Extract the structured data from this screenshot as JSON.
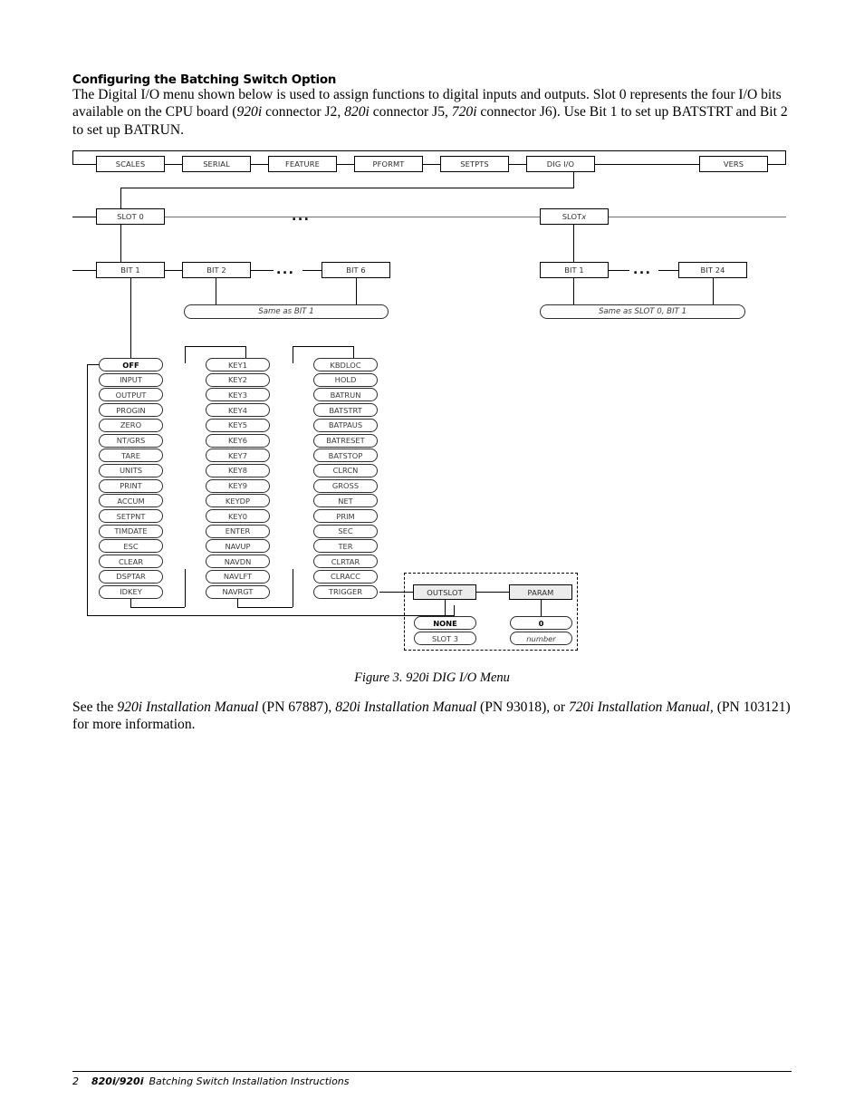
{
  "section": {
    "title": "Configuring the Batching Switch Option",
    "intro_parts": [
      {
        "t": "The Digital I/O menu shown below is used to assign functions to digital inputs and outputs. Slot 0 represents the four I/O bits available on the CPU board (",
        "i": false
      },
      {
        "t": "920i",
        "i": true
      },
      {
        "t": " connector J2, ",
        "i": false
      },
      {
        "t": "820i",
        "i": true
      },
      {
        "t": " connector J5, ",
        "i": false
      },
      {
        "t": "720i",
        "i": true
      },
      {
        "t": " connector J6). Use Bit 1 to set up BATSTRT and Bit 2 to set up BATRUN.",
        "i": false
      }
    ],
    "reference_parts": [
      {
        "t": "See the ",
        "i": false
      },
      {
        "t": "920i Installation Manual",
        "i": true
      },
      {
        "t": " (PN 67887), ",
        "i": false
      },
      {
        "t": "820i Installation Manual",
        "i": true
      },
      {
        "t": " (PN 93018), or ",
        "i": false
      },
      {
        "t": "720i Installation Manual,",
        "i": true
      },
      {
        "t": " (PN 103121) for more information.",
        "i": false
      }
    ]
  },
  "figure": {
    "caption": "Figure 3. 920i DIG I/O Menu",
    "ellipsis": "...",
    "top_menu": [
      {
        "label": "SCALES"
      },
      {
        "label": "SERIAL"
      },
      {
        "label": "FEATURE"
      },
      {
        "label": "PFORMT"
      },
      {
        "label": "SETPTS"
      },
      {
        "label": "DIG I/O"
      },
      {
        "label": "VERS"
      }
    ],
    "slot_row": [
      {
        "label": "SLOT 0"
      },
      {
        "label_pre": "SLOT ",
        "label_italic": "x"
      }
    ],
    "bit_row_left": [
      {
        "label": "BIT 1"
      },
      {
        "label": "BIT 2"
      },
      {
        "label": "BIT 6"
      }
    ],
    "bit_row_right": [
      {
        "label": "BIT 1"
      },
      {
        "label": "BIT 24"
      }
    ],
    "same_as_left": "Same as BIT 1",
    "same_as_right": "Same as SLOT 0, BIT 1",
    "column1": [
      {
        "label": "OFF",
        "bold": true
      },
      {
        "label": "INPUT"
      },
      {
        "label": "OUTPUT"
      },
      {
        "label": "PROGIN"
      },
      {
        "label": "ZERO"
      },
      {
        "label": "NT/GRS"
      },
      {
        "label": "TARE"
      },
      {
        "label": "UNITS"
      },
      {
        "label": "PRINT"
      },
      {
        "label": "ACCUM"
      },
      {
        "label": "SETPNT"
      },
      {
        "label": "TIMDATE"
      },
      {
        "label": "ESC"
      },
      {
        "label": "CLEAR"
      },
      {
        "label": "DSPTAR"
      },
      {
        "label": "IDKEY"
      }
    ],
    "column2": [
      {
        "label": "KEY1"
      },
      {
        "label": "KEY2"
      },
      {
        "label": "KEY3"
      },
      {
        "label": "KEY4"
      },
      {
        "label": "KEY5"
      },
      {
        "label": "KEY6"
      },
      {
        "label": "KEY7"
      },
      {
        "label": "KEY8"
      },
      {
        "label": "KEY9"
      },
      {
        "label": "KEYDP"
      },
      {
        "label": "KEY0"
      },
      {
        "label": "ENTER"
      },
      {
        "label": "NAVUP"
      },
      {
        "label": "NAVDN"
      },
      {
        "label": "NAVLFT"
      },
      {
        "label": "NAVRGT"
      }
    ],
    "column3": [
      {
        "label": "KBDLOC"
      },
      {
        "label": "HOLD"
      },
      {
        "label": "BATRUN"
      },
      {
        "label": "BATSTRT"
      },
      {
        "label": "BATPAUS"
      },
      {
        "label": "BATRESET"
      },
      {
        "label": "BATSTOP"
      },
      {
        "label": "CLRCN"
      },
      {
        "label": "GROSS"
      },
      {
        "label": "NET"
      },
      {
        "label": "PRIM"
      },
      {
        "label": "SEC"
      },
      {
        "label": "TER"
      },
      {
        "label": "CLRTAR"
      },
      {
        "label": "CLRACC"
      },
      {
        "label": "TRIGGER"
      }
    ],
    "outslot_group": {
      "outslot_label": "OUTSLOT",
      "param_label": "PARAM",
      "outslot_values": [
        {
          "label": "NONE",
          "bold": true
        },
        {
          "label": "SLOT 3"
        }
      ],
      "param_values": [
        {
          "label": "0",
          "bold": true
        },
        {
          "label": "number",
          "italic": true
        }
      ]
    }
  },
  "footer": {
    "page": "2",
    "model": "820i/920i",
    "doc": "Batching Switch Installation Instructions"
  }
}
